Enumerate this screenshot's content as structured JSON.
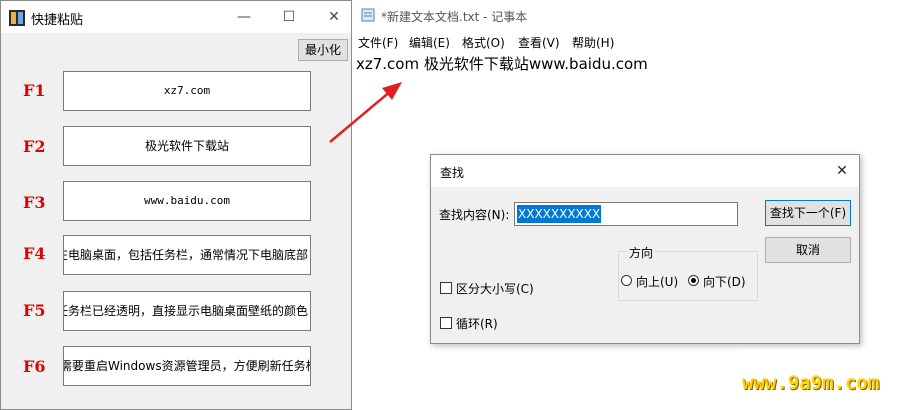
{
  "quickpaste": {
    "title": "快捷粘贴",
    "minimize_label": "最小化",
    "window_controls": {
      "min": "—",
      "max": "☐",
      "close": "✕"
    },
    "rows": [
      {
        "key": "F1",
        "value": "xz7.com"
      },
      {
        "key": "F2",
        "value": "极光软件下载站"
      },
      {
        "key": "F3",
        "value": "www.baidu.com"
      },
      {
        "key": "F4",
        "value": "在电脑桌面，包括任务栏，通常情况下电脑底部"
      },
      {
        "key": "F5",
        "value": "任务栏已经透明，直接显示电脑桌面壁纸的颜色"
      },
      {
        "key": "F6",
        "value": "需要重启Windows资源管理员，方便刷新任务栏"
      }
    ]
  },
  "notepad": {
    "title": "*新建文本文档.txt - 记事本",
    "menu": [
      "文件(F)",
      "编辑(E)",
      "格式(O)",
      "查看(V)",
      "帮助(H)"
    ],
    "content": "xz7.com 极光软件下载站www.baidu.com"
  },
  "find_dialog": {
    "title": "查找",
    "close": "✕",
    "find_label": "查找内容(N):",
    "find_value": "XXXXXXXXXX",
    "find_next": "查找下一个(F)",
    "cancel": "取消",
    "direction_label": "方向",
    "up_label": "向上(U)",
    "down_label": "向下(D)",
    "match_case_label": "区分大小写(C)",
    "wrap_label": "循环(R)"
  },
  "watermark": "www.9a9m.com",
  "colors": {
    "fkey": "#e00000",
    "selection": "#0078d7",
    "arrow": "#e02020",
    "watermark": "#ffd400"
  }
}
